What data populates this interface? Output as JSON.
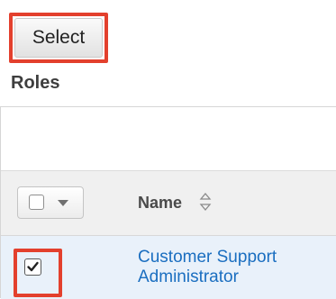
{
  "toolbar": {
    "select_label": "Select"
  },
  "roles_section": {
    "title": "Roles"
  },
  "table": {
    "columns": [
      {
        "label": "Name",
        "sortable": true
      }
    ],
    "rows": [
      {
        "name": "Customer Support Administrator",
        "checked": true
      }
    ]
  },
  "icons": {
    "sort": "sort-icon",
    "dropdown": "chevron-down-icon",
    "checkbox": "checkbox-icon"
  },
  "colors": {
    "highlight": "#e3402d",
    "link": "#1a6ec0",
    "row_background": "#e9f1fa",
    "header_background": "#f0f0f0"
  }
}
